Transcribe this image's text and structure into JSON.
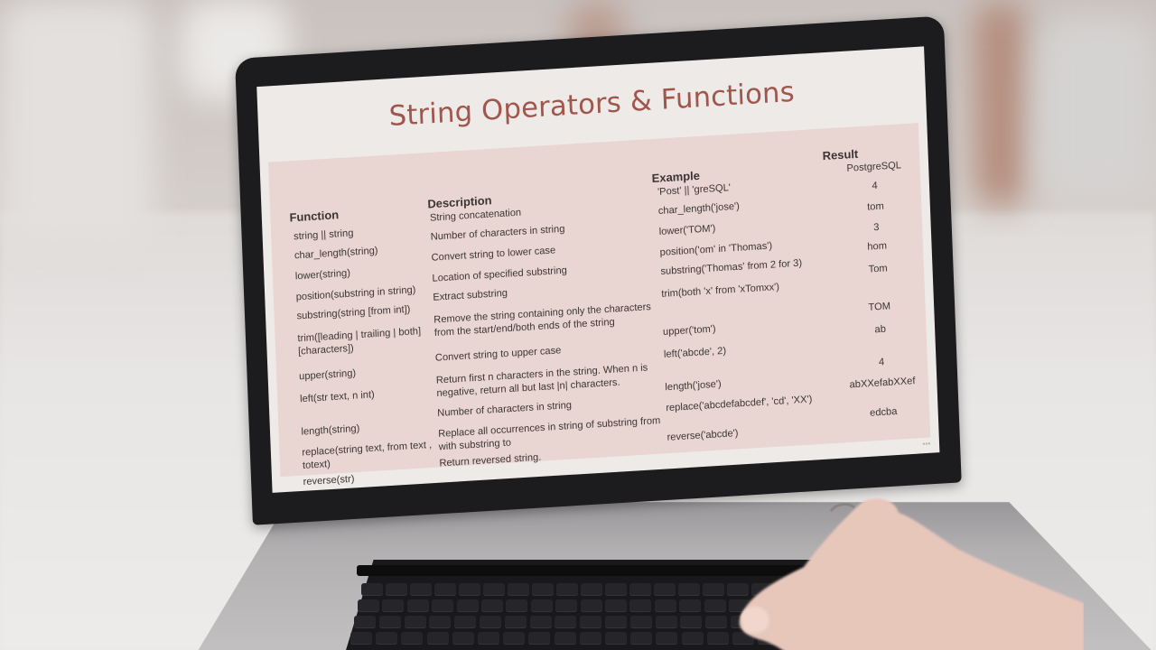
{
  "slide": {
    "title": "String Operators & Functions",
    "headers": {
      "function": "Function",
      "description": "Description",
      "example": "Example",
      "result": "Result"
    },
    "rows": [
      {
        "function": "string || string",
        "description": "String concatenation",
        "example": "'Post' || 'greSQL'",
        "result": "PostgreSQL"
      },
      {
        "function": "char_length(string)",
        "description": "Number of characters in string",
        "example": "char_length('jose')",
        "result": "4"
      },
      {
        "function": "lower(string)",
        "description": "Convert string to lower case",
        "example": "lower('TOM')",
        "result": "tom"
      },
      {
        "function": "position(substring in string)",
        "description": "Location of specified substring",
        "example": "position('om' in 'Thomas')",
        "result": "3"
      },
      {
        "function": "substring(string [from int])",
        "description": "Extract substring",
        "example": "substring('Thomas' from 2 for 3)",
        "result": "hom"
      },
      {
        "function": "trim([leading | trailing | both] [characters])",
        "description": "Remove the string containing only the characters from the start/end/both ends of the string",
        "example": "trim(both 'x' from 'xTomxx')",
        "result": "Tom"
      },
      {
        "function": "upper(string)",
        "description": "Convert string to upper case",
        "example": "upper('tom')",
        "result": "TOM"
      },
      {
        "function": "left(str text, n int)",
        "description": "Return first n characters in the string. When n is negative, return all but last |n| characters.",
        "example": "left('abcde', 2)",
        "result": "ab"
      },
      {
        "function": "length(string)",
        "description": "Number of characters in string",
        "example": "length('jose')",
        "result": "4"
      },
      {
        "function": "replace(string text, from text , totext)",
        "description": "Replace all occurrences in string of substring from with substring to",
        "example": "replace('abcdefabcdef', 'cd', 'XX')",
        "result": "abXXefabXXef"
      },
      {
        "function": "reverse(str)",
        "description": "Return reversed string.",
        "example": "reverse('abcde')",
        "result": "edcba"
      }
    ]
  },
  "colors": {
    "title": "#a0564c",
    "panel": "#e9d5d1",
    "screen": "#eeeae8",
    "bezel": "#1c1b1d"
  },
  "icons": {
    "hand": "hand-on-keyboard-icon",
    "laptop": "laptop-icon"
  }
}
